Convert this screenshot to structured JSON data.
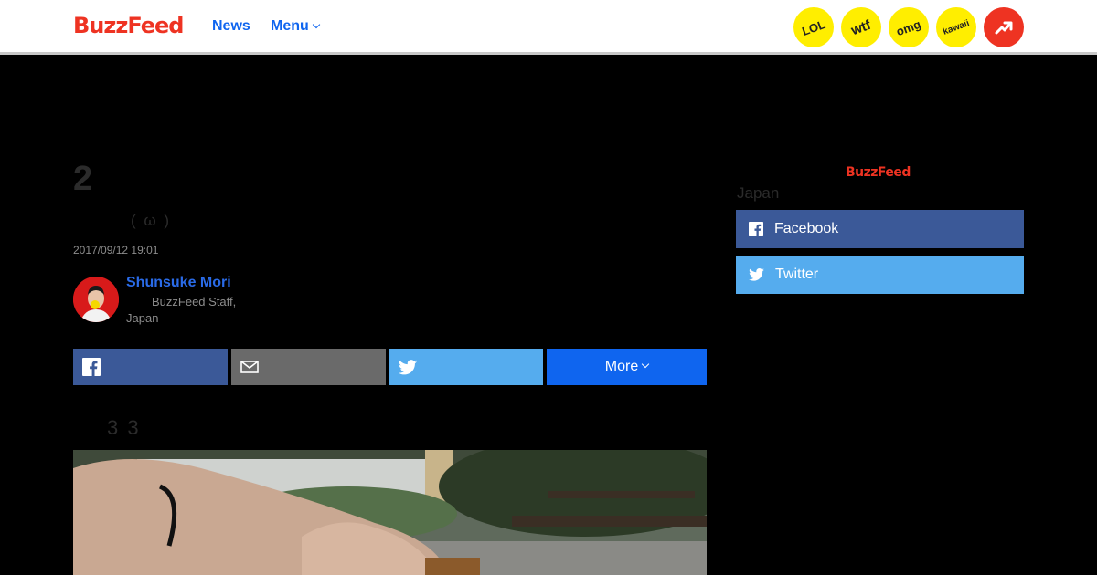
{
  "header": {
    "logo": "BuzzFeed",
    "nav": {
      "news": "News",
      "menu": "Menu"
    },
    "badges": {
      "lol": "LOL",
      "wtf": "wtf",
      "omg": "omg",
      "kawaii": "kawaii"
    },
    "trending_icon": "trending-arrow-icon"
  },
  "article": {
    "title": "2",
    "subtitle": "( ω )",
    "timestamp": "2017/09/12 19:01",
    "author": {
      "name": "Shunsuke Mori",
      "role": "BuzzFeed Staff,",
      "location": "Japan"
    },
    "share": {
      "more_label": "More"
    },
    "body_text": "3 3"
  },
  "sidebar": {
    "logo": "BuzzFeed",
    "label": "Japan",
    "facebook_label": "Facebook",
    "twitter_label": "Twitter"
  },
  "colors": {
    "brand_red": "#ee3322",
    "link_blue": "#0f65ef",
    "facebook": "#3b5998",
    "twitter": "#55acee",
    "email": "#6a6a6a",
    "badge_yellow": "#ffee00"
  }
}
